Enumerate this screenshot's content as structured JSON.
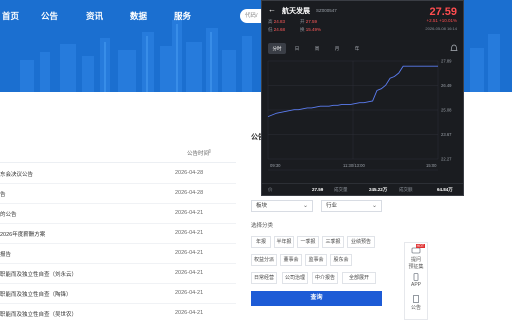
{
  "nav": {
    "items": [
      "首页",
      "公告",
      "资讯",
      "数据",
      "服务"
    ],
    "code_input_placeholder": "代码/"
  },
  "list": {
    "col_time": "公告时间",
    "sort_glyph": "⇕",
    "rows": [
      {
        "title": "东会决议公告",
        "date": "2026-04-28"
      },
      {
        "title": "告",
        "date": "2026-04-28"
      },
      {
        "title": "的公告",
        "date": "2026-04-21"
      },
      {
        "title": "2026年度薪酬方案",
        "date": "2026-04-21"
      },
      {
        "title": "报告",
        "date": "2026-04-21"
      },
      {
        "title": "职能而及独立性自查（刘永云）",
        "date": "2026-04-21"
      },
      {
        "title": "职能而及独立性自查（陶锋）",
        "date": "2026-04-21"
      },
      {
        "title": "职能而及独立性自查（吴世农）",
        "date": "2026-04-21"
      }
    ]
  },
  "filter": {
    "title": "公告",
    "select_exchange": "板块",
    "select_industry": "行业",
    "section_label": "选择分类",
    "chips": [
      [
        "年报",
        "半年报",
        "一季报",
        "三季报",
        "业绩预告"
      ],
      [
        "权益分派",
        "董事会",
        "监事会",
        "股东会"
      ],
      [
        "日常经营",
        "公司治理",
        "中介报告",
        "全部展开"
      ]
    ],
    "query_label": "查询"
  },
  "side_tools": [
    {
      "label": "提问",
      "sub": "预征集",
      "badge": "HOT"
    },
    {
      "label": "APP"
    },
    {
      "label": "公告"
    }
  ],
  "popup": {
    "back_glyph": "←",
    "name": "航天发展",
    "code": "SZ000547",
    "price": "27.59",
    "change": "+2.51 +10.01%",
    "time": "2026-05-08 16:14",
    "quotes": {
      "high_label": "高",
      "high": "24.83",
      "open_label": "开",
      "open": "27.59",
      "low_label": "低",
      "low": "24.68",
      "turnover_label": "换",
      "turnover": "15.49%"
    },
    "tabs": [
      "分时",
      "日",
      "周",
      "月",
      "年"
    ],
    "chart_labels": {
      "y_ticks": [
        "27.89",
        "26.49",
        "25.08",
        "23.67",
        "22.27"
      ],
      "x_ticks": [
        "09:30",
        "11:30/13:00",
        "15:00"
      ]
    },
    "footer": {
      "price_label": "价",
      "price": "27.59",
      "vol_label": "成交量",
      "vol": "245.22万",
      "amount_label": "成交额",
      "amount": "64.84万"
    }
  },
  "chart_data": {
    "type": "line",
    "title": "",
    "xlabel": "",
    "ylabel": "",
    "x_ticks": [
      "09:30",
      "11:30/13:00",
      "15:00"
    ],
    "ylim": [
      22.27,
      27.89
    ],
    "series": [
      {
        "values": [
          24.7,
          24.8,
          24.9,
          24.95,
          25.0,
          25.05,
          25.1,
          25.1,
          25.15,
          25.2,
          25.2,
          25.25,
          25.3,
          25.3,
          25.3,
          25.35,
          25.35,
          25.4,
          25.4,
          25.4,
          25.45,
          25.5,
          25.5,
          25.55,
          25.6,
          26.2,
          26.3,
          26.5,
          26.9,
          27.0,
          27.2,
          27.59,
          27.59,
          27.59,
          27.59,
          27.59,
          27.59,
          27.59,
          27.59,
          27.59
        ]
      }
    ],
    "colors": {
      "line": "#5b7cf0",
      "grid": "#2c2f36"
    }
  }
}
